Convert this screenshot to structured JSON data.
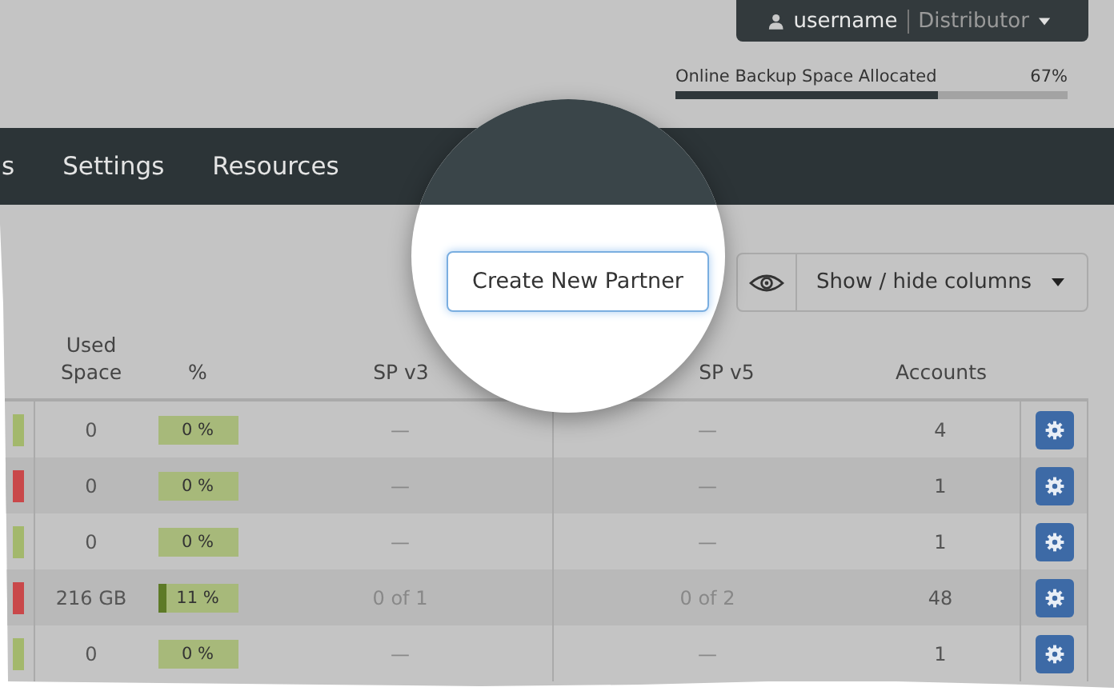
{
  "user_menu": {
    "username": "username",
    "role": "Distributor"
  },
  "backup_space": {
    "label": "Online Backup Space Allocated",
    "reading": "67%",
    "level": 0.67
  },
  "nav": [
    {
      "label": "s"
    },
    {
      "label": "Settings"
    },
    {
      "label": "Resources"
    }
  ],
  "toolbar": {
    "create_button": "Create New Partner",
    "columns_button": "Show / hide columns"
  },
  "table": {
    "columns": [
      {
        "label": "Used Space"
      },
      {
        "label": "%"
      },
      {
        "label": "SP v3"
      },
      {
        "label": "SP v5"
      },
      {
        "label": "Accounts"
      }
    ],
    "rows": [
      {
        "color": "#a3b86c",
        "used_space": "0",
        "percent": "0 %",
        "level": 0,
        "sp_v3": "—",
        "sp_v5": "—",
        "accounts": "4"
      },
      {
        "color": "#c9484a",
        "used_space": "0",
        "percent": "0 %",
        "level": 0,
        "sp_v3": "—",
        "sp_v5": "—",
        "accounts": "1"
      },
      {
        "color": "#a3b86c",
        "used_space": "0",
        "percent": "0 %",
        "level": 0,
        "sp_v3": "—",
        "sp_v5": "—",
        "accounts": "1"
      },
      {
        "color": "#c9484a",
        "used_space": "216 GB",
        "percent": "11 %",
        "level": 0.11,
        "sp_v3": "0 of 1",
        "sp_v5": "0 of 2",
        "accounts": "48"
      },
      {
        "color": "#a3b86c",
        "used_space": "0",
        "percent": "0 %",
        "level": 0,
        "sp_v3": "—",
        "sp_v5": "—",
        "accounts": "1"
      }
    ]
  }
}
